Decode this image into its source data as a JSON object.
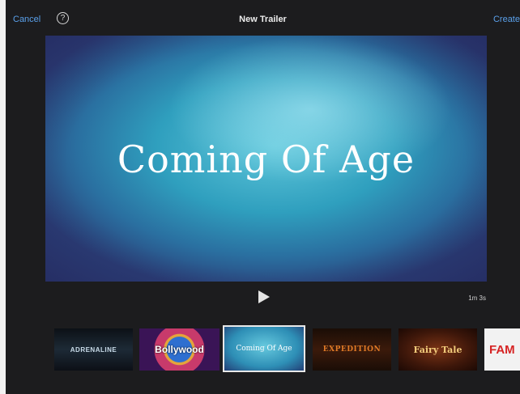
{
  "header": {
    "cancel_label": "Cancel",
    "help_icon": "?",
    "title": "New Trailer",
    "create_label": "Create"
  },
  "preview": {
    "title_text": "Coming Of Age",
    "duration": "1m 3s"
  },
  "icons": {
    "help": "question-circle-icon",
    "play": "play-icon"
  },
  "themes": [
    {
      "label": "ADRENALINE"
    },
    {
      "label": "Bollywood"
    },
    {
      "label": "Coming Of Age",
      "selected": true
    },
    {
      "label": "EXPEDITION"
    },
    {
      "label": "Fairy Tale"
    },
    {
      "label": "FAM"
    }
  ],
  "colors": {
    "accent": "#5aa0ea",
    "background": "#1c1c1e"
  }
}
